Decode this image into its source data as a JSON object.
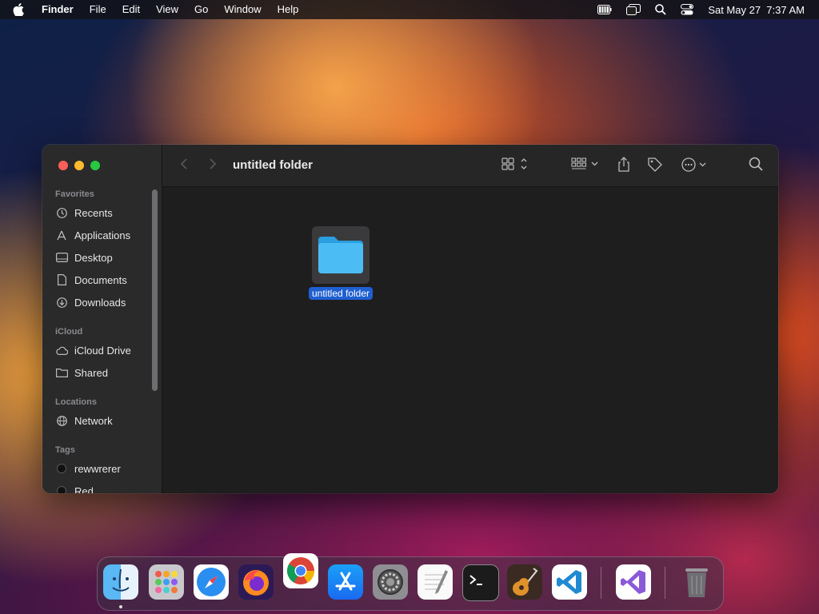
{
  "menubar": {
    "app_name": "Finder",
    "items": [
      "File",
      "Edit",
      "View",
      "Go",
      "Window",
      "Help"
    ],
    "datetime": "Sat May 27  7:37 AM"
  },
  "window": {
    "title": "untitled folder",
    "sidebar": {
      "sections": {
        "favorites": "Favorites",
        "icloud": "iCloud",
        "locations": "Locations",
        "tags": "Tags"
      },
      "favorites": [
        "Recents",
        "Applications",
        "Desktop",
        "Documents",
        "Downloads"
      ],
      "icloud": [
        "iCloud Drive",
        "Shared"
      ],
      "locations": [
        "Network"
      ],
      "tags": [
        "rewwrerer",
        "Red"
      ]
    },
    "items": [
      {
        "name": "untitled folder",
        "kind": "folder",
        "selected": true
      }
    ]
  },
  "dock": {
    "apps": [
      "Finder",
      "Launchpad",
      "Safari",
      "Firefox",
      "Google Chrome",
      "App Store",
      "System Settings",
      "TextEdit",
      "Terminal",
      "GarageBand",
      "Visual Studio Code",
      "Visual Studio",
      "Trash"
    ]
  },
  "colors": {
    "selection": "#1f5fd1",
    "close": "#ff5f57",
    "minimize": "#febc2e",
    "maximize": "#28c840",
    "folder": "#3fb4f0"
  }
}
